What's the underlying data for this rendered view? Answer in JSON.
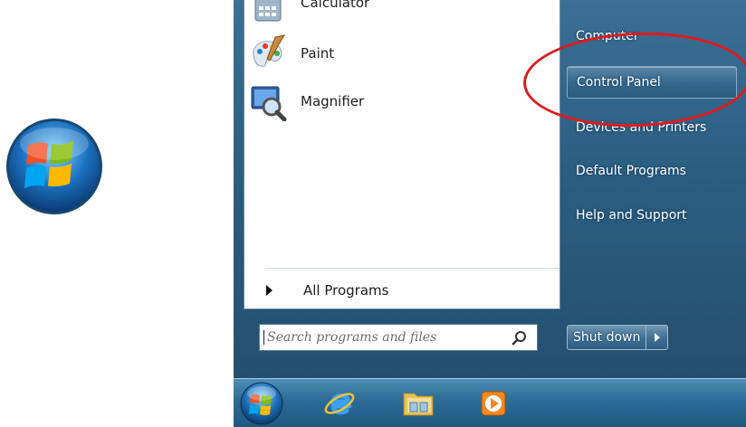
{
  "start_menu": {
    "programs": [
      {
        "label": "Calculator",
        "icon": "calculator-icon"
      },
      {
        "label": "Paint",
        "icon": "paint-icon"
      },
      {
        "label": "Magnifier",
        "icon": "magnifier-icon"
      }
    ],
    "all_programs_label": "All Programs",
    "search": {
      "placeholder": "Search programs and files",
      "value": ""
    },
    "right_items": [
      {
        "label": "Computer"
      },
      {
        "label": "Control Panel",
        "highlighted": true
      },
      {
        "label": "Devices and Printers"
      },
      {
        "label": "Default Programs"
      },
      {
        "label": "Help and Support"
      }
    ],
    "shutdown_label": "Shut down"
  },
  "annotation": {
    "type": "red-ellipse",
    "target": "Control Panel",
    "color": "#e01b1b"
  },
  "taskbar": {
    "items": [
      "windows-start-orb",
      "internet-explorer-icon",
      "windows-explorer-icon",
      "windows-media-player-icon"
    ]
  },
  "colors": {
    "menu_blue": "#2c5e82",
    "taskbar_blue": "#2e6e98",
    "highlight_red": "#e01b1b"
  }
}
